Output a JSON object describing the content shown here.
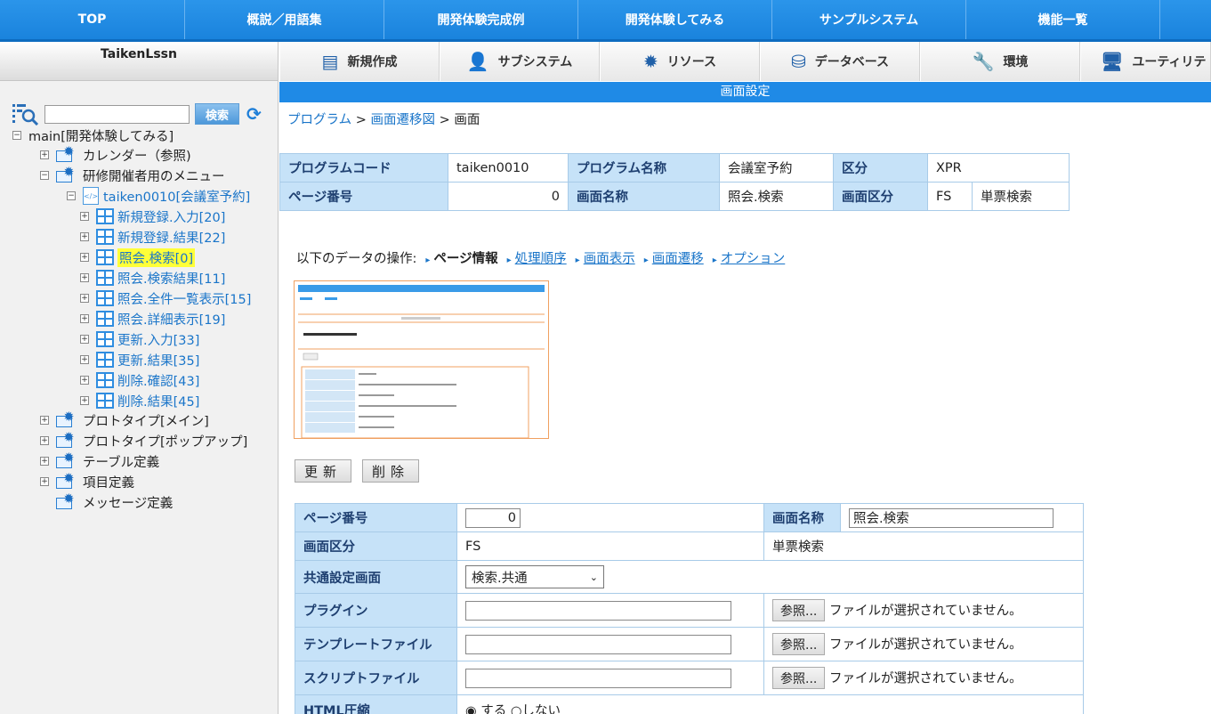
{
  "top_nav": [
    "TOP",
    "概説／用語集",
    "開発体験完成例",
    "開発体験してみる",
    "サンプルシステム",
    "機能一覧"
  ],
  "left": {
    "title": "TaikenLssn",
    "search_button": "検索",
    "tree": [
      {
        "label": "main[開発体験してみる]"
      },
      {
        "label": "カレンダー（参照)"
      },
      {
        "label": "研修開催者用のメニュー"
      },
      {
        "label": "taiken0010[会議室予約]"
      },
      {
        "label": "新規登録.入力[20]"
      },
      {
        "label": "新規登録.結果[22]"
      },
      {
        "label": "照会.検索[0]"
      },
      {
        "label": "照会.検索結果[11]"
      },
      {
        "label": "照会.全件一覧表示[15]"
      },
      {
        "label": "照会.詳細表示[19]"
      },
      {
        "label": "更新.入力[33]"
      },
      {
        "label": "更新.結果[35]"
      },
      {
        "label": "削除.確認[43]"
      },
      {
        "label": "削除.結果[45]"
      },
      {
        "label": "プロトタイプ[メイン]"
      },
      {
        "label": "プロトタイプ[ポップアップ]"
      },
      {
        "label": "テーブル定義"
      },
      {
        "label": "項目定義"
      },
      {
        "label": "メッセージ定義"
      }
    ]
  },
  "toolbar": [
    "新規作成",
    "サブシステム",
    "リソース",
    "データベース",
    "環境",
    "ユーティリテ"
  ],
  "section_title": "画面設定",
  "breadcrumb": {
    "b1": "プログラム",
    "sep": ">",
    "b2": "画面遷移図",
    "b3": "画面"
  },
  "info": {
    "program_code_label": "プログラムコード",
    "program_code": "taiken0010",
    "program_name_label": "プログラム名称",
    "program_name": "会議室予約",
    "kubun_label": "区分",
    "kubun": "XPR",
    "page_no_label": "ページ番号",
    "page_no": "0",
    "screen_name_label": "画面名称",
    "screen_name": "照会.検索",
    "screen_kubun_label": "画面区分",
    "screen_kubun": "FS",
    "screen_kubun_name": "単票検索"
  },
  "ops": {
    "label": "以下のデータの操作:",
    "current": "ページ情報",
    "links": [
      "処理順序",
      "画面表示",
      "画面遷移",
      "オプション"
    ]
  },
  "buttons": {
    "update": "更新",
    "delete": "削除"
  },
  "form": {
    "page_no_label": "ページ番号",
    "page_no": "0",
    "screen_name_label": "画面名称",
    "screen_name": "照会.検索",
    "screen_kubun_label": "画面区分",
    "screen_kubun": "FS",
    "screen_kubun_name": "単票検索",
    "common_label": "共通設定画面",
    "common_value": "検索.共通",
    "plugin_label": "プラグイン",
    "template_label": "テンプレートファイル",
    "script_label": "スクリプトファイル",
    "browse": "参照...",
    "no_file": "ファイルが選択されていません。",
    "html_label": "HTML圧縮",
    "radio_yes": "する",
    "radio_no": "しない"
  }
}
